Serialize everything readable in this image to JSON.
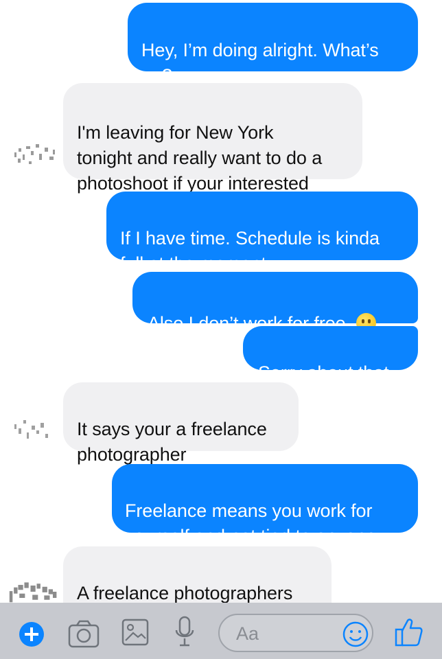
{
  "conversation": {
    "messages": [
      {
        "side": "outgoing",
        "text": "Hey, I’m doing alright. What’s\nup?"
      },
      {
        "side": "incoming",
        "text": "I'm leaving for New York\ntonight and really want to do a\nphotoshoot if your interested"
      },
      {
        "side": "outgoing",
        "text": "If I have time. Schedule is kinda\nfull at the moment"
      },
      {
        "side": "outgoing",
        "text": "Also I don’t work for free.",
        "emoji": "neutral-face"
      },
      {
        "side": "outgoing",
        "text": "Sorry about that"
      },
      {
        "side": "incoming",
        "text": "It says your a freelance\nphotographer"
      },
      {
        "side": "outgoing",
        "text": "Freelance means you work for\nyourself and not tied to anyone"
      },
      {
        "side": "incoming",
        "text": "A freelance photographers\nmeans you work for free."
      }
    ]
  },
  "composer": {
    "placeholder": "Aa",
    "icons": [
      "plus-icon",
      "camera-icon",
      "gallery-icon",
      "microphone-icon",
      "emoji-icon",
      "thumbs-up-icon"
    ]
  },
  "colors": {
    "outgoing_bubble": "#0b84ff",
    "incoming_bubble": "#f0f0f2",
    "toolbar": "#c7c9cf",
    "accent": "#0b84ff"
  }
}
